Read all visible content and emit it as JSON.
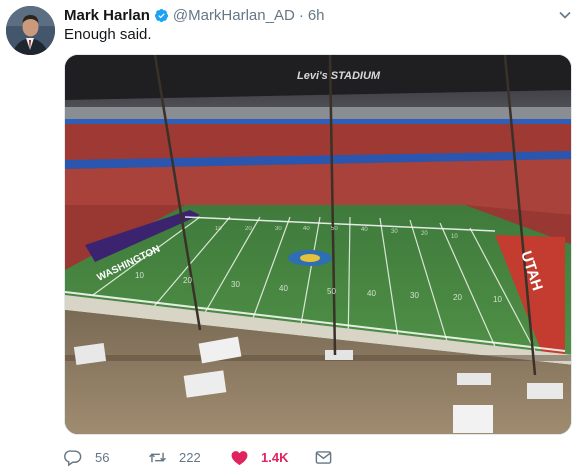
{
  "tweet": {
    "author_name": "Mark Harlan",
    "handle": "@MarkHarlan_AD",
    "separator": "·",
    "time": "6h",
    "text": "Enough said."
  },
  "media": {
    "stadium_sign": "Levi's STADIUM",
    "endzone_left": "WASHINGTON",
    "endzone_right": "UTAH",
    "yard_numbers_far": [
      "10",
      "20",
      "30",
      "40",
      "50",
      "40",
      "30",
      "20",
      "10"
    ],
    "yard_numbers_near": [
      "10",
      "20",
      "30",
      "40",
      "50",
      "40",
      "30",
      "20",
      "10"
    ]
  },
  "actions": {
    "replies": "56",
    "retweets": "222",
    "likes": "1.4K"
  },
  "colors": {
    "like_active": "#e0245e",
    "verified": "#1da1f2",
    "muted": "#657786"
  },
  "icons": [
    "verified-badge-icon",
    "caret-down-icon",
    "reply-icon",
    "retweet-icon",
    "heart-icon",
    "direct-message-icon"
  ]
}
